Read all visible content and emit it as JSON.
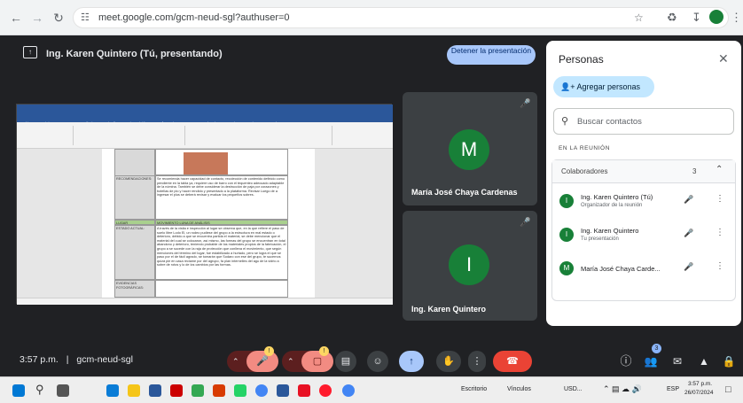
{
  "browser": {
    "url": "meet.google.com/gcm-neud-sgl?authuser=0",
    "back_icon": "arrow-left",
    "forward_icon": "arrow-right",
    "reload_icon": "reload"
  },
  "meet": {
    "presenting_label": "Ing. Karen Quintero (Tú, presentando)",
    "stop_presenting": "Detener la presentación",
    "time": "3:57 p.m.",
    "separator": "|",
    "meeting_code": "gcm-neud-sgl",
    "participants_badge": "3",
    "mic_badge": "!",
    "cam_badge": "!"
  },
  "tiles": [
    {
      "initial": "M",
      "name": "María José Chaya Cardenas"
    },
    {
      "initial": "I",
      "name": "Ing. Karen Quintero"
    }
  ],
  "shared_doc": {
    "tabs": [
      "Archivo",
      "Inicio",
      "Insertar",
      "Dibujar",
      "Diseño",
      "Disposición",
      "Referencias",
      "Correspondencia",
      "Revisar",
      "Vista",
      "Ayuda"
    ],
    "recomendaciones_label": "RECOMENDACIONES:",
    "recomendaciones_text": "Se recomienda hacer capacidad de contacto, recolección de contenido definido como pendiente en la tabla ya, requiere uso de barro con el tequenteo adecuado adaptable de la nómina. También se debe considerar la destrucción de paja por corazones y botellas de plo y hacer rendido y presentado a la plataforma. Revisar Luego de a ingresar el plus se deberá revisar y evaluar los pequeños sobres.",
    "section_label": "LUGAR",
    "section_header": "MOVIMIENTO LUNA DE ANÁLISIS",
    "estado_label": "ESTADO ACTUAL:",
    "estado_text": "A través de la visita e inspección al lugar se observa que, en la que refiere el paso de suelo libre Lodo El, un rodeo pudiese del grupo a la estructura en mal estado o deterioro, debido a que se encuentra partida el material, se debe mencionar que el material del cual se colocaron, así mismo, las formas del grupo se encuentran en total abandono y deterioro, teniendo probable de los materiales propios de la fabricación, el grupo a se sucede con la raja de protección que conlleva el movimiento, que según menciones del término del lugar, fue estabilizado a hurtado, pero se logra el que se paso por el de fácil agrado, se tomarán que Sodaro con ese del grupo, te sucernos quizá pie en casa reclame por del agrupo, fa plan internelles del agu de la vidrio a sobre de rotos y lo de los cambios por las formas.",
    "evidencias_label": "EVIDENCIAS FOTOGRÁFICAS:"
  },
  "panel": {
    "title": "Personas",
    "add_people": "Agregar personas",
    "search_placeholder": "Buscar contactos",
    "in_meeting": "EN LA REUNIÓN",
    "collaborators": "Colaboradores",
    "collaborators_count": "3",
    "participants": [
      {
        "initial": "I",
        "name": "Ing. Karen Quintero (Tú)",
        "sub": "Organizador de la reunión"
      },
      {
        "initial": "I",
        "name": "Ing. Karen Quintero",
        "sub": "Tu presentación"
      },
      {
        "initial": "M",
        "name": "María José Chaya Carde...",
        "sub": ""
      }
    ]
  },
  "taskbar": {
    "escritorio": "Escritorio",
    "vinculos": "Vínculos",
    "usd": "USD...",
    "lang": "ESP",
    "time": "3:57 p.m.",
    "date": "26/07/2024"
  },
  "colors": {
    "meet_bg": "#202124",
    "avatar_green": "#188038",
    "stop_button": "#a8c7fa",
    "end_call": "#ea4335",
    "word_blue": "#2b579a"
  }
}
